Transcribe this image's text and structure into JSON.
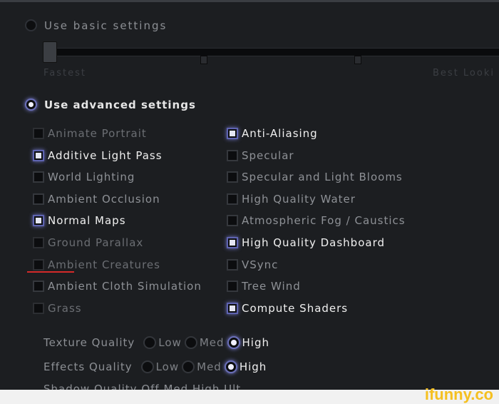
{
  "basic": {
    "label": "Use basic settings",
    "selected": false
  },
  "slider": {
    "min_label": "Fastest",
    "max_label": "Best Looki",
    "value": 0
  },
  "advanced": {
    "label": "Use advanced settings",
    "selected": true
  },
  "left_options": [
    {
      "label": "Animate Portrait",
      "state": "disabled"
    },
    {
      "label": "Additive Light Pass",
      "state": "on"
    },
    {
      "label": "World Lighting",
      "state": "off"
    },
    {
      "label": "Ambient Occlusion",
      "state": "off"
    },
    {
      "label": "Normal Maps",
      "state": "on"
    },
    {
      "label": "Ground Parallax",
      "state": "disabled"
    },
    {
      "label": "Ambient Creatures",
      "state": "disabled"
    },
    {
      "label": "Ambient Cloth Simulation",
      "state": "off"
    },
    {
      "label": "Grass",
      "state": "disabled"
    }
  ],
  "right_options": [
    {
      "label": "Anti-Aliasing",
      "state": "on"
    },
    {
      "label": "Specular",
      "state": "off"
    },
    {
      "label": "Specular and Light Blooms",
      "state": "off"
    },
    {
      "label": "High Quality Water",
      "state": "off"
    },
    {
      "label": "Atmospheric Fog / Caustics",
      "state": "off"
    },
    {
      "label": "High Quality Dashboard",
      "state": "on"
    },
    {
      "label": "VSync",
      "state": "off"
    },
    {
      "label": "Tree Wind",
      "state": "off"
    },
    {
      "label": "Compute Shaders",
      "state": "on"
    }
  ],
  "texture_quality": {
    "label": "Texture Quality",
    "options": [
      "Low",
      "Med",
      "High"
    ],
    "selected": "High"
  },
  "effects_quality": {
    "label": "Effects Quality",
    "options": [
      "Low",
      "Med",
      "High"
    ],
    "selected": "High"
  },
  "shadow_quality_partial": {
    "text": "Shadow Quality  Off  Med  High  Ult"
  },
  "watermark": "ifunny.co",
  "colors": {
    "background": "#1c1e21",
    "accent_glow": "#7c80d8",
    "annotation_underline": "#d42a2a",
    "watermark": "#f5c020"
  }
}
